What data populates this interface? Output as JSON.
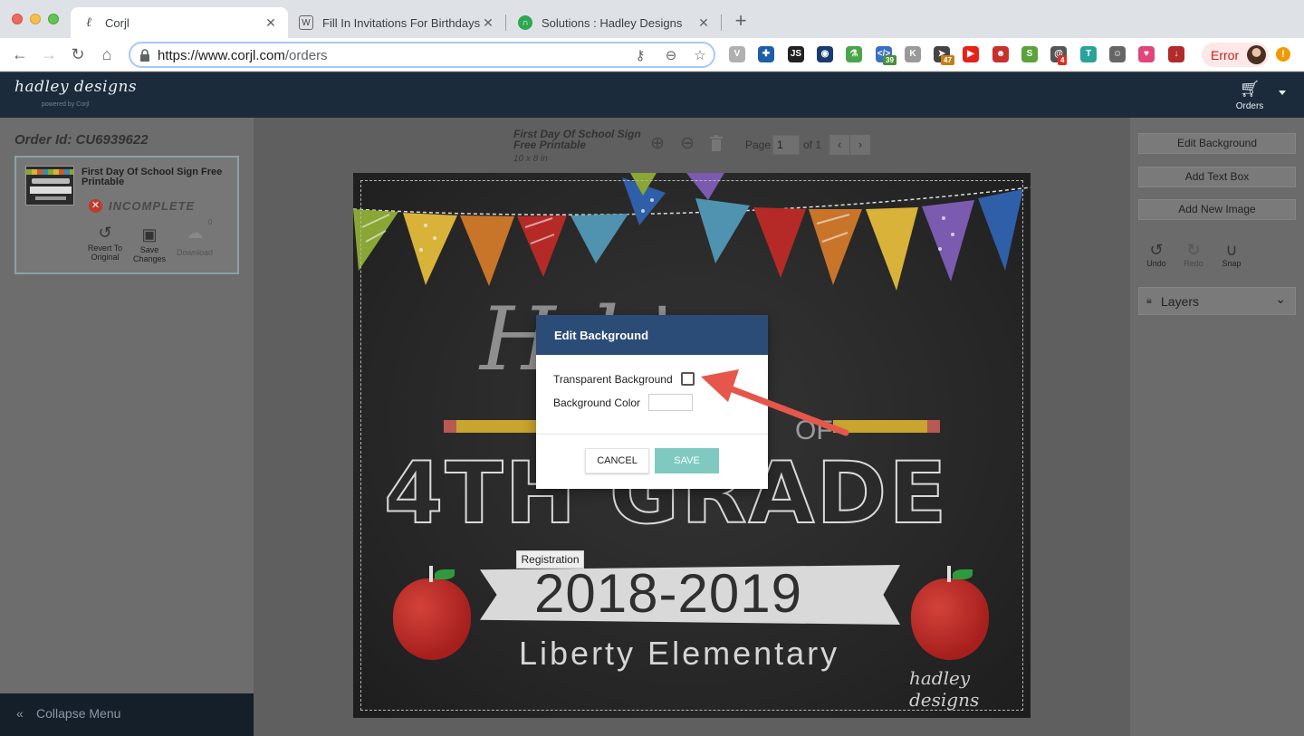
{
  "browser": {
    "tabs": [
      {
        "title": "Corjl",
        "active": true
      },
      {
        "title": "Fill In Invitations For Birthdays,",
        "active": false
      },
      {
        "title": "Solutions : Hadley Designs",
        "active": false
      }
    ],
    "url_host": "https://www.corjl.com",
    "url_path": "/orders",
    "extensions": [
      {
        "icon": "v-shield-icon",
        "color": "#b0b0b0"
      },
      {
        "icon": "crosshair-icon",
        "color": "#1d5fa8"
      },
      {
        "icon": "js-icon",
        "color": "#222222"
      },
      {
        "icon": "eye-icon",
        "color": "#1a3b6e"
      },
      {
        "icon": "flask-icon",
        "color": "#4aa54a"
      },
      {
        "icon": "code-icon",
        "color": "#3a6fc4",
        "badge": "39"
      },
      {
        "icon": "k-icon",
        "color": "#9a9a9a"
      },
      {
        "icon": "cursor-icon",
        "color": "#444444",
        "badge": "47"
      },
      {
        "icon": "youtube-icon",
        "color": "#e62117"
      },
      {
        "icon": "monster-icon",
        "color": "#c9302c"
      },
      {
        "icon": "shopify-icon",
        "color": "#5aa33c"
      },
      {
        "icon": "at-icon",
        "color": "#555555",
        "badge": "4"
      },
      {
        "icon": "shirt-icon",
        "color": "#2aa39a"
      },
      {
        "icon": "robot-icon",
        "color": "#666666"
      },
      {
        "icon": "heart-icon",
        "color": "#e0467a"
      },
      {
        "icon": "download-box-icon",
        "color": "#b22a2a"
      }
    ],
    "error_label": "Error",
    "warning_glyph": "!"
  },
  "app": {
    "logo": "hadley designs",
    "logo_sub": "powered by Corjl",
    "orders_label": "Orders"
  },
  "left_panel": {
    "order_id": "Order Id: CU6939622",
    "card": {
      "title": "First Day Of School Sign Free Printable",
      "status": "INCOMPLETE",
      "actions": [
        {
          "label": "Revert To Original",
          "icon": "revert-icon"
        },
        {
          "label": "Save Changes",
          "icon": "save-icon"
        },
        {
          "label": "Download",
          "icon": "cloud-download-icon",
          "count": "0"
        }
      ]
    },
    "collapse_label": "Collapse Menu"
  },
  "workspace": {
    "doc_title": "First Day Of School Sign Free Printable",
    "doc_size": "10 x 8 in",
    "page_label": "Page",
    "page_value": "1",
    "page_of": "of 1",
    "art": {
      "name_text": "H    h's",
      "of_text": "OF",
      "grade_text": "4TH GRADE",
      "year_text": "2018-2019",
      "school_text": "Liberty Elementary",
      "signature": "hadley designs"
    },
    "tooltip": "Registration"
  },
  "right_panel": {
    "buttons": [
      "Edit Background",
      "Add Text Box",
      "Add New Image"
    ],
    "tools": [
      {
        "label": "Undo",
        "icon": "undo-icon"
      },
      {
        "label": "Redo",
        "icon": "redo-icon"
      },
      {
        "label": "Snap",
        "icon": "magnet-icon"
      }
    ],
    "layers_label": "Layers"
  },
  "modal": {
    "title": "Edit Background",
    "transparent_label": "Transparent Background",
    "transparent_checked": false,
    "color_label": "Background Color",
    "color_value": "",
    "cancel_label": "CANCEL",
    "save_label": "SAVE"
  },
  "colors": {
    "app_header": "#1b2b3b",
    "modal_header": "#2b4c76",
    "save_button": "#7fc9c0",
    "annotation_arrow": "#e5574a"
  }
}
